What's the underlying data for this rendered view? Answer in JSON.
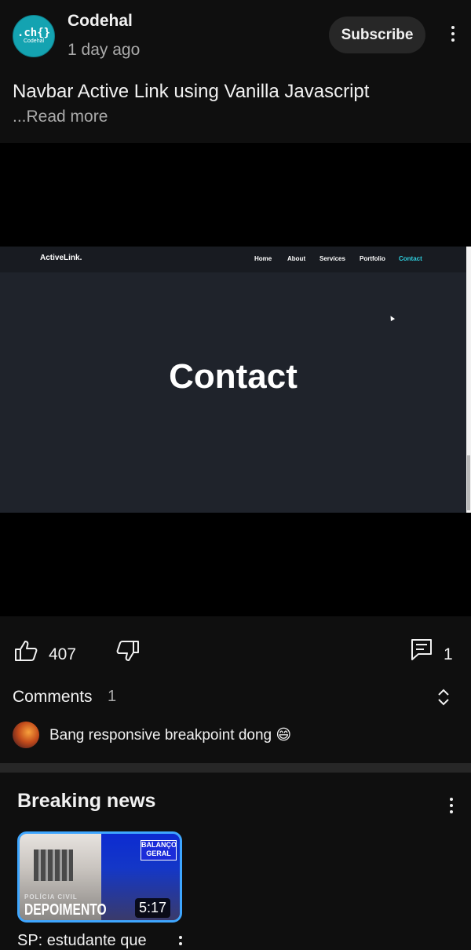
{
  "post": {
    "channel_name": "Codehal",
    "avatar_text_main": ".ch{}",
    "avatar_text_sub": "Codehal",
    "time": "1 day ago",
    "subscribe_label": "Subscribe",
    "title": "Navbar Active Link using Vanilla Javascript",
    "read_more": "...Read more"
  },
  "video": {
    "brand": "ActiveLink.",
    "nav_items": [
      "Home",
      "About",
      "Services",
      "Portfolio",
      "Contact"
    ],
    "active_item": "Contact",
    "heading": "Contact"
  },
  "actions": {
    "likes": "407",
    "comment_count": "1"
  },
  "comments": {
    "title": "Comments",
    "count": "1",
    "top_comment": "Bang responsive breakpoint dong 😄"
  },
  "shelf": {
    "title": "Breaking news",
    "video": {
      "duration": "5:17",
      "thumb_text_small": "POLÍCIA CIVIL",
      "thumb_text_big": "DEPOIMENTO",
      "thumb_badge": "BALANÇO GERAL",
      "title": "SP: estudante que"
    }
  },
  "colors": {
    "background": "#0f0f0f",
    "accent_link": "#2fd0df",
    "thumb_border": "#3ea6ff",
    "avatar": "#14a3b1"
  }
}
